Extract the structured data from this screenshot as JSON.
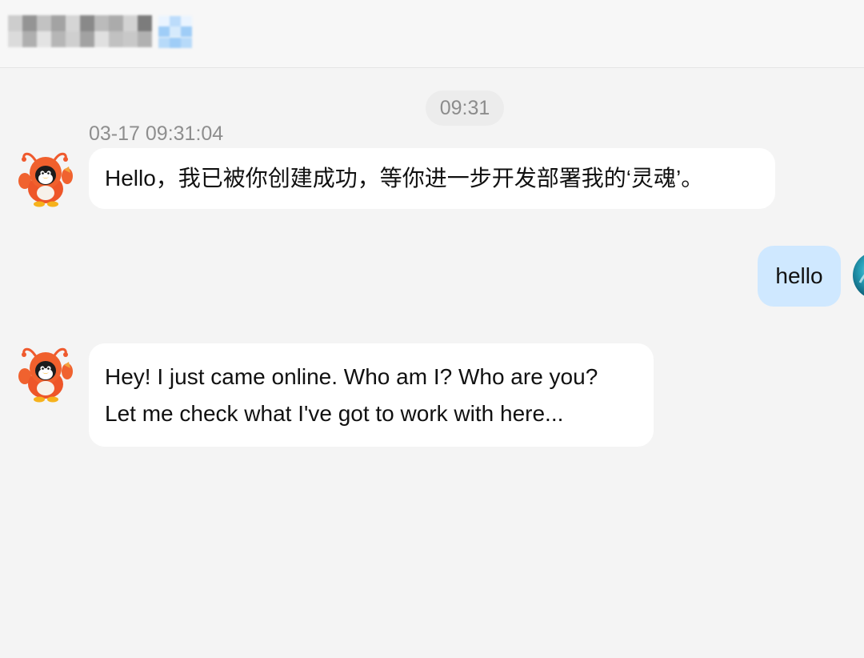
{
  "header": {
    "title": "",
    "title_blurred": true,
    "status_icon": "blurred-status-icon"
  },
  "chat": {
    "time_divider": "09:31",
    "messages": [
      {
        "sender": "bot",
        "timestamp": "03-17 09:31:04",
        "avatar": "lobster-penguin-avatar",
        "text": "Hello，我已被你创建成功，等你进一步开发部署我的‘灵魂’。"
      },
      {
        "sender": "user",
        "avatar": "user-avatar-teal",
        "text": "hello"
      },
      {
        "sender": "bot",
        "avatar": "lobster-penguin-avatar",
        "lines": [
          "Hey! I just came online. Who am I? Who are you?",
          "Let me check what I've got to work with here..."
        ]
      }
    ]
  },
  "colors": {
    "background": "#f4f4f4",
    "header_background": "#f7f7f7",
    "incoming_bubble": "#ffffff",
    "outgoing_bubble": "#cfe8ff",
    "timestamp_text": "#8e8e8e",
    "bot_avatar_orange": "#ef5a2e"
  }
}
